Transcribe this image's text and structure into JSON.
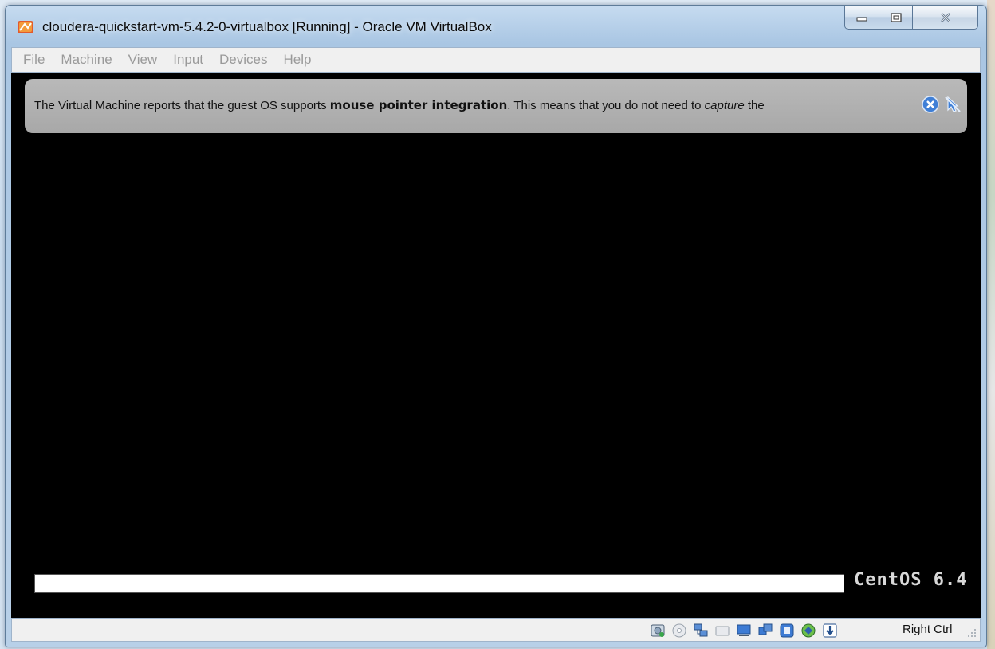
{
  "window": {
    "title": "cloudera-quickstart-vm-5.4.2-0-virtualbox [Running] - Oracle VM VirtualBox"
  },
  "menubar": {
    "items": [
      "File",
      "Machine",
      "View",
      "Input",
      "Devices",
      "Help"
    ]
  },
  "notice": {
    "text_before": "The Virtual Machine reports that the guest OS supports ",
    "bold": "mouse pointer integration",
    "text_middle": ". This means that you do not need to ",
    "italic": "capture",
    "text_after": " the"
  },
  "boot": {
    "progress": 1.0,
    "os_label": "CentOS 6.4"
  },
  "statusbar": {
    "host_key": "Right Ctrl",
    "icons": [
      "hard-disk-icon",
      "optical-drive-icon",
      "network-icon",
      "usb-icon",
      "shared-folders-icon",
      "display-icon",
      "video-capture-icon",
      "virtualization-icon",
      "mouse-integration-icon"
    ]
  },
  "colors": {
    "vm_background": "#000000",
    "notice_background": "#b0b0b0",
    "menu_text_disabled": "#9a9a9a"
  }
}
